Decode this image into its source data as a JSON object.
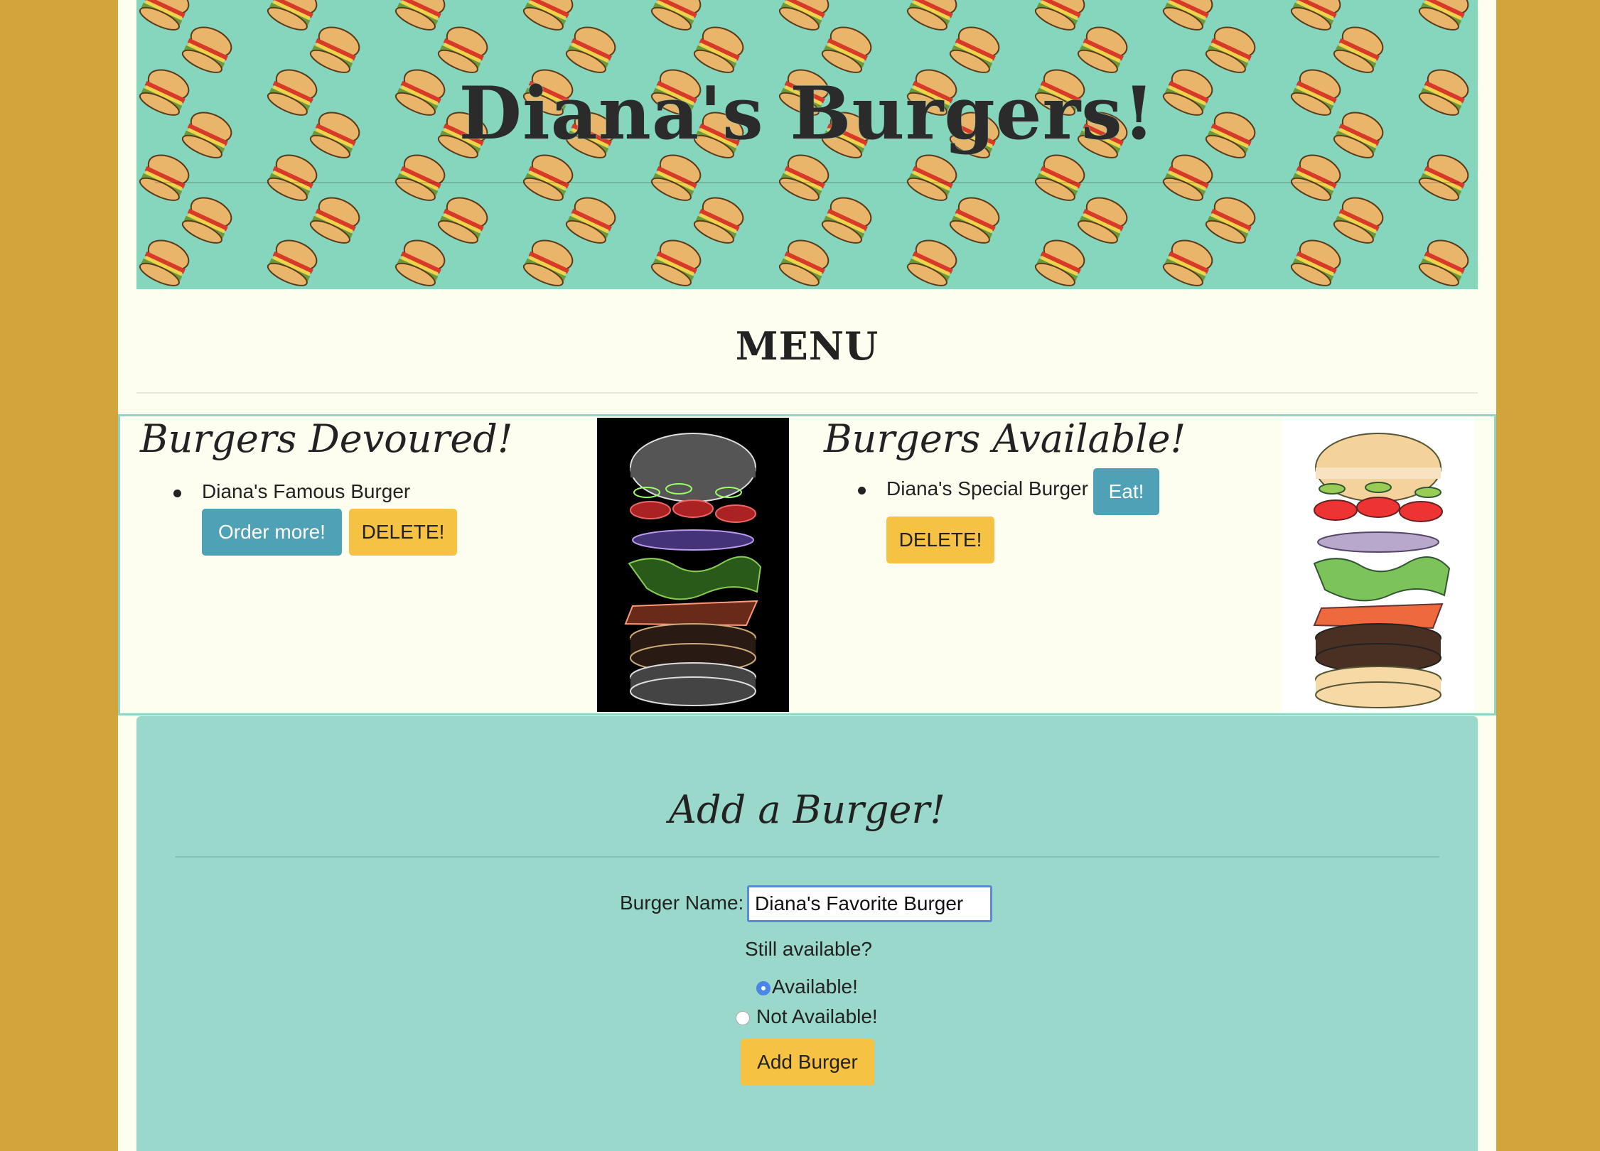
{
  "header": {
    "title": "Diana's Burgers!"
  },
  "menu": {
    "heading": "MENU",
    "devoured": {
      "title": "Burgers Devoured!",
      "items": [
        {
          "name": "Diana's Famous Burger",
          "order_label": "Order more!",
          "delete_label": "DELETE!"
        }
      ]
    },
    "available": {
      "title": "Burgers Available!",
      "items": [
        {
          "name": "Diana's Special Burger",
          "eat_label": "Eat!",
          "delete_label": "DELETE!"
        }
      ]
    }
  },
  "add_form": {
    "title": "Add a Burger!",
    "name_label": "Burger Name:",
    "name_value": "Diana's Favorite Burger",
    "question": "Still available?",
    "options": [
      {
        "label": "Available!",
        "checked": true
      },
      {
        "label": "Not Available!",
        "checked": false
      }
    ],
    "submit_label": "Add Burger"
  },
  "colors": {
    "background": "#d2a43b",
    "page": "#fefef0",
    "banner": "#85d6bd",
    "panel": "#99d8cb",
    "info_button": "#4fa1b6",
    "warning_button": "#f6c244"
  }
}
